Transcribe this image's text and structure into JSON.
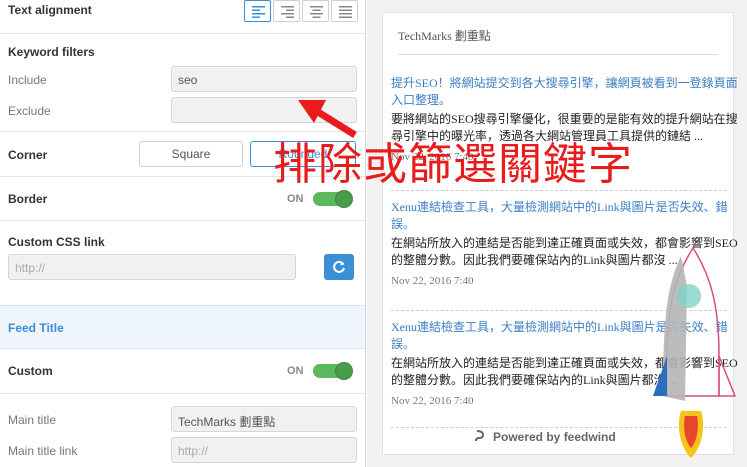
{
  "settings": {
    "text_alignment_label": "Text alignment",
    "keyword_filters_label": "Keyword filters",
    "include_label": "Include",
    "include_value": "seo",
    "exclude_label": "Exclude",
    "exclude_value": "",
    "corner_label": "Corner",
    "corner_square": "Square",
    "corner_rounded": "Rounded",
    "border_label": "Border",
    "border_state": "ON",
    "custom_css_label": "Custom CSS link",
    "custom_css_placeholder": "http://",
    "feed_title_section": "Feed Title",
    "custom_label": "Custom",
    "custom_state": "ON",
    "main_title_label": "Main title",
    "main_title_value": "TechMarks 劃重點",
    "main_title_link_label": "Main title link",
    "main_title_link_placeholder": "http://"
  },
  "preview": {
    "widget_title": "TechMarks 劃重點",
    "posts": [
      {
        "title": "提升SEO！將網站提交到各大搜尋引擎，讓網頁被看到一登錄頁面入口整理。",
        "excerpt": "要將網站的SEO搜尋引擎優化，很重要的是能有效的提升網站在搜尋引擎中的曝光率，透過各大網站管理員工具提供的鏈結 ...",
        "date": "Nov 22, 2016 7:40"
      },
      {
        "title": "Xenu連結檢查工具，大量檢測網站中的Link與圖片是否失效、錯誤。",
        "excerpt": "在網站所放入的連結是否能到達正確頁面或失效，都會影響到SEO的整體分數。因此我們要確保站內的Link與圖片都沒 ...",
        "date": "Nov 22, 2016 7:40"
      },
      {
        "title": "Xenu連結檢查工具，大量檢測網站中的Link與圖片是否失效、錯誤。",
        "excerpt": "在網站所放入的連結是否能到達正確頁面或失效，都會影響到SEO的整體分數。因此我們要確保站內的Link與圖片都沒 ...",
        "date": "Nov 22, 2016 7:40"
      }
    ],
    "powered_by": "Powered by feedwind"
  },
  "annotation": {
    "text": "排除或篩選關鍵字",
    "color": "#e81c1c"
  },
  "colors": {
    "accent": "#3b8fd6",
    "toggle_on": "#5cb85c"
  },
  "icons": [
    "align-left-icon",
    "align-right-icon",
    "align-center-icon",
    "align-justify-icon",
    "refresh-icon",
    "feedwind-logo-icon",
    "red-arrow-annotation",
    "rocket-logo"
  ]
}
